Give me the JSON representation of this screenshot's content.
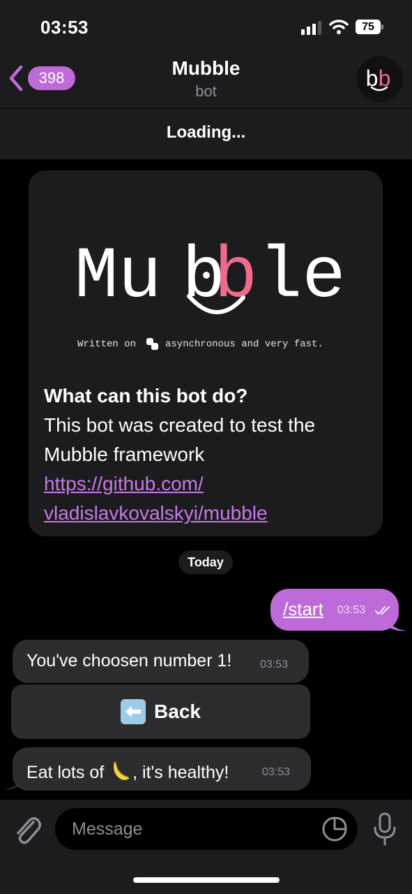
{
  "status_bar": {
    "time": "03:53",
    "battery": "75"
  },
  "header": {
    "unread_count": "398",
    "title": "Mubble",
    "subtitle": "bot",
    "avatar_text": "bb"
  },
  "banner": {
    "text": "Loading..."
  },
  "info_card": {
    "logo_text": "Mubble",
    "logo_caption_before": "Written on",
    "logo_caption_after": "asynchronous and very fast.",
    "heading": "What can this bot do?",
    "description": "This bot was created to test the Mubble framework",
    "link_line1": "https://github.com/",
    "link_line2": "vladislavkovalskyi/mubble"
  },
  "date_separator": "Today",
  "messages": [
    {
      "direction": "out",
      "text": "/start",
      "time": "03:53"
    },
    {
      "direction": "in",
      "text": "You've choosen number 1!",
      "time": "03:53"
    },
    {
      "direction": "in",
      "text_before": "Eat lots of",
      "text_after": ", it's healthy!",
      "time": "03:53"
    }
  ],
  "inline_keyboard": {
    "back_label": "Back"
  },
  "input": {
    "placeholder": "Message"
  },
  "icons": {
    "back": "chevron-left-icon",
    "signal": "cellular-signal-icon",
    "wifi": "wifi-icon",
    "attach": "paperclip-icon",
    "sticker": "sticker-icon",
    "mic": "microphone-icon",
    "banana": "banana-emoji-icon",
    "back_arrow": "left-arrow-emoji-icon"
  },
  "colors": {
    "accent": "#bf6ad9",
    "link": "#c879e6",
    "logo_pink": "#f06b8a"
  }
}
